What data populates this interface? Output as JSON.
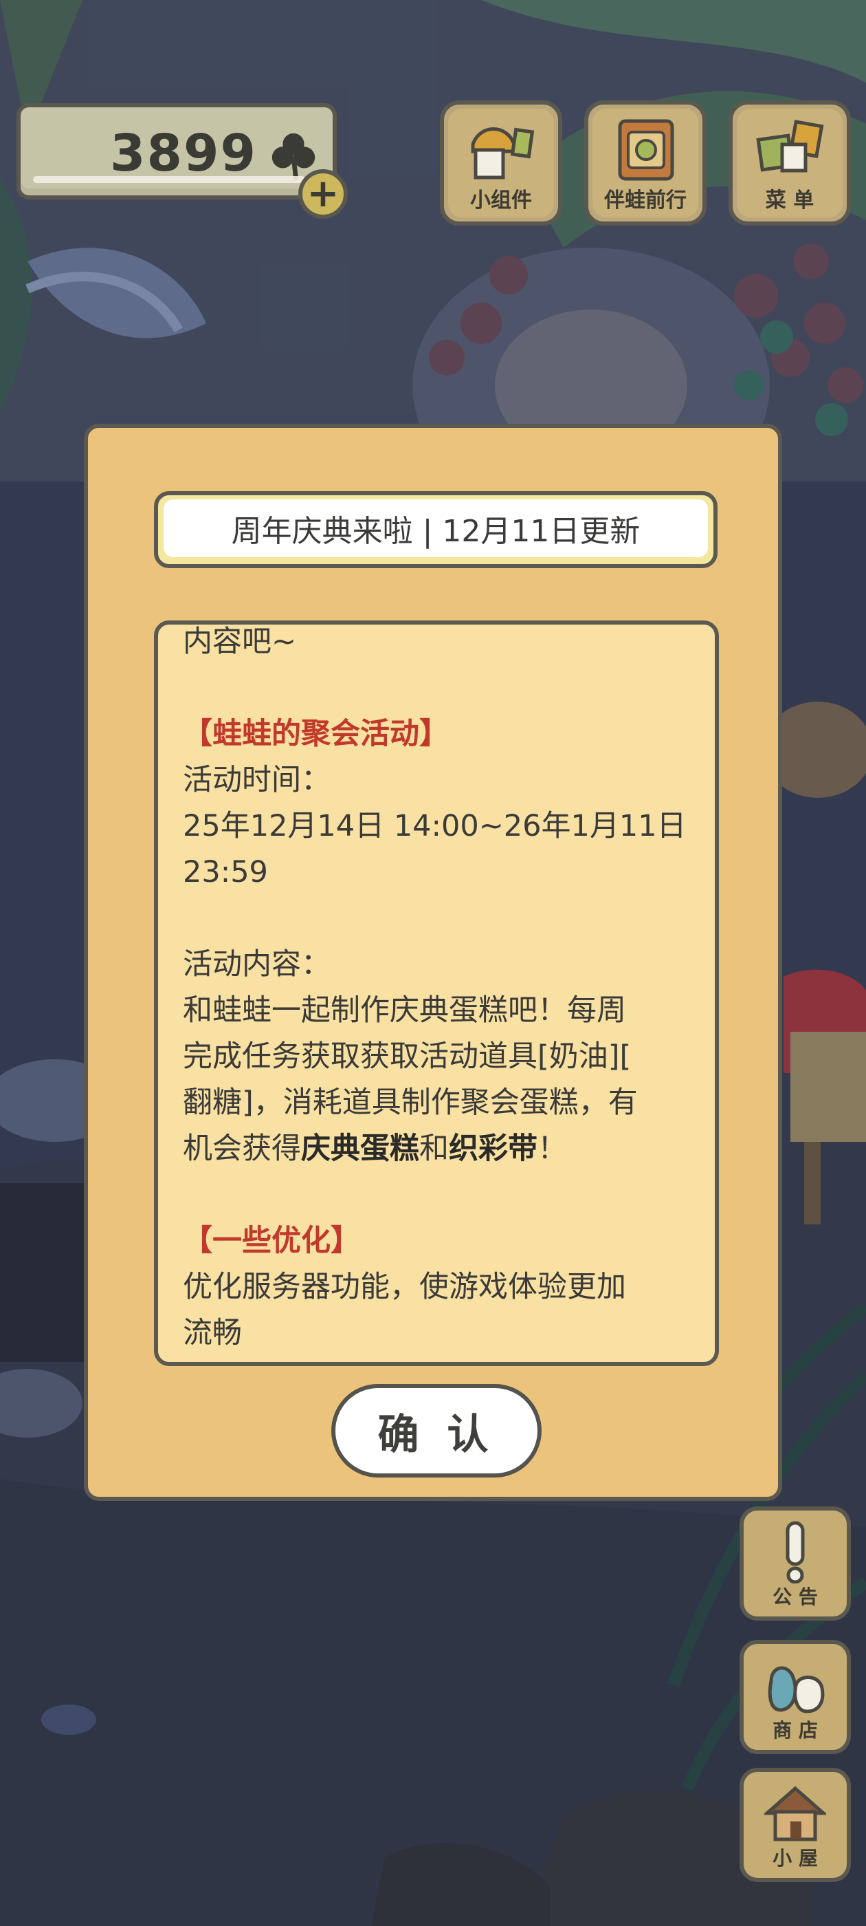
{
  "currency": {
    "count": "3899",
    "icon": "clover-icon",
    "add_icon": "plus-icon"
  },
  "top_menu": [
    {
      "label": "小组件",
      "icon": "widget-icon"
    },
    {
      "label": "伴蛙前行",
      "icon": "frog-companion-icon"
    },
    {
      "label": "菜 单",
      "icon": "menu-cards-icon"
    }
  ],
  "side_menu": [
    {
      "label": "公 告",
      "icon": "exclamation-icon"
    },
    {
      "label": "商 店",
      "icon": "bags-icon"
    },
    {
      "label": "小 屋",
      "icon": "house-icon"
    }
  ],
  "dialog": {
    "title": "周年庆典来啦 | 12月11日更新",
    "partial_top_line": "内容吧~",
    "section1_title": "【蛙蛙的聚会活动】",
    "time_label": "活动时间：",
    "time_line1": "25年12月14日 14:00~26年1月11日",
    "time_line2": "23:59",
    "content_label": "活动内容：",
    "content_line1": "和蛙蛙一起制作庆典蛋糕吧！每周",
    "content_line2": "完成任务获取获取活动道具[奶油][",
    "content_line3": "翻糖]，消耗道具制作聚会蛋糕，有",
    "content_line4_pre": "机会获得",
    "content_bold1": "庆典蛋糕",
    "content_mid": "和",
    "content_bold2": "织彩带",
    "content_end": "！",
    "section2_title": "【一些优化】",
    "opt_line1": "优化服务器功能，使游戏体验更加",
    "opt_line2": "流畅",
    "confirm_label": "确 认"
  },
  "colors": {
    "dialog_bg": "#ebc37d",
    "content_bg": "#f9e0a3",
    "section_title": "#c0392b",
    "border": "#5b5950"
  }
}
